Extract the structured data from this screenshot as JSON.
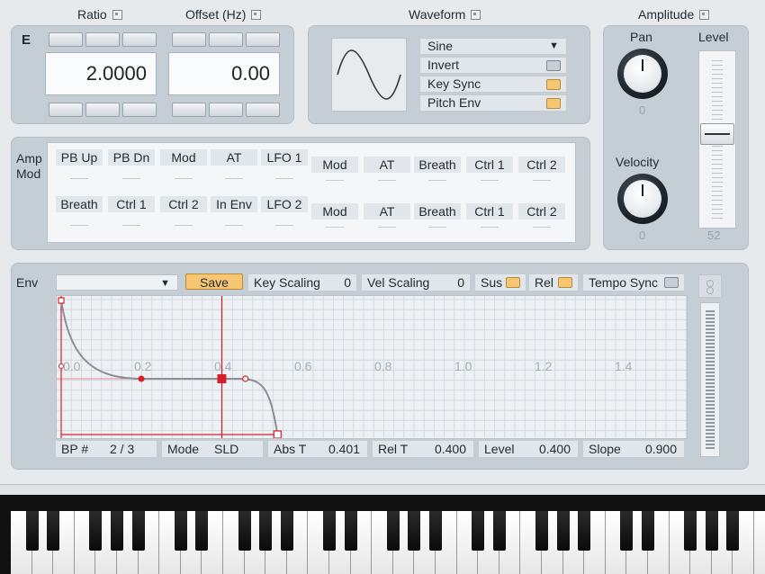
{
  "oscillator": {
    "ratio_label": "Ratio",
    "offset_label": "Offset (Hz)",
    "operator_label": "E",
    "ratio_value": "2.0000",
    "offset_value": "0.00"
  },
  "waveform": {
    "title": "Waveform",
    "selected": "Sine",
    "invert_label": "Invert",
    "key_sync_label": "Key Sync",
    "pitch_env_label": "Pitch Env"
  },
  "amplitude": {
    "title": "Amplitude",
    "pan_label": "Pan",
    "pan_value": "0",
    "level_label": "Level",
    "level_value": "52",
    "velocity_label": "Velocity",
    "velocity_value": "0"
  },
  "amp_mod": {
    "label_line1": "Amp",
    "label_line2": "Mod",
    "row1": [
      "PB Up",
      "PB Dn",
      "Mod",
      "AT",
      "LFO 1"
    ],
    "row1_right": [
      "Mod",
      "AT",
      "Breath",
      "Ctrl 1",
      "Ctrl 2"
    ],
    "row2": [
      "Breath",
      "Ctrl 1",
      "Ctrl 2",
      "In Env",
      "LFO 2"
    ],
    "row2_right": [
      "Mod",
      "AT",
      "Breath",
      "Ctrl 1",
      "Ctrl 2"
    ]
  },
  "envelope": {
    "label": "Env",
    "save_label": "Save",
    "key_scaling_label": "Key Scaling",
    "key_scaling_value": "0",
    "vel_scaling_label": "Vel Scaling",
    "vel_scaling_value": "0",
    "sus_label": "Sus",
    "rel_label": "Rel",
    "tempo_sync_label": "Tempo Sync",
    "time_ticks": [
      "0.0",
      "0.2",
      "0.4",
      "0.6",
      "0.8",
      "1.0",
      "1.2",
      "1.4"
    ],
    "bp_label": "BP #",
    "bp_value": "2 / 3",
    "mode_label": "Mode",
    "mode_value": "SLD",
    "abs_t_label": "Abs T",
    "abs_t_value": "0.401",
    "rel_t_label": "Rel T",
    "rel_t_value": "0.400",
    "level_label": "Level",
    "level_value": "0.400",
    "slope_label": "Slope",
    "slope_value": "0.900"
  },
  "colors": {
    "accent_red": "#d4202a",
    "led_orange": "#f7c673",
    "panel_grey": "#c5ced5"
  }
}
